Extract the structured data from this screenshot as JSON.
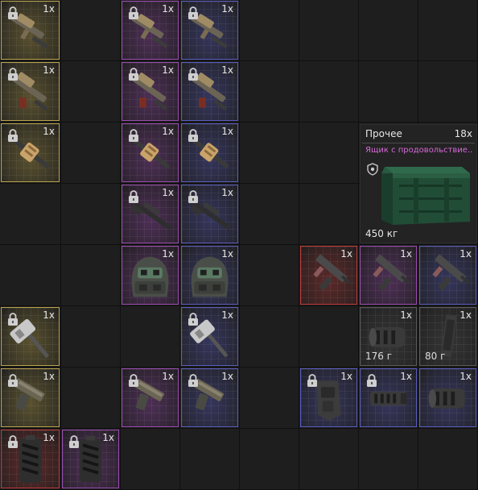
{
  "colors": {
    "gold": "#b8a24a",
    "purple": "#9a4ab0",
    "blue": "#5a5cc0",
    "red": "#c03a3a",
    "gray": "#5a5a5a",
    "featured_name": "#d76ad8"
  },
  "featured": {
    "category": "Прочее",
    "count": "18x",
    "name": "Ящик с продовольствие..",
    "weight": "450 кг",
    "icon": "crate-icon",
    "shield_icon": "shield-icon"
  },
  "slots": [
    {
      "col": 0,
      "row": 0,
      "rarity": "gold",
      "icon": "rifle-icon",
      "qty": "1x",
      "locked": true
    },
    {
      "col": 2,
      "row": 0,
      "rarity": "purple",
      "icon": "rifle-icon",
      "qty": "1x",
      "locked": true
    },
    {
      "col": 3,
      "row": 0,
      "rarity": "blue",
      "icon": "rifle-icon",
      "qty": "1x",
      "locked": true
    },
    {
      "col": 0,
      "row": 1,
      "rarity": "gold",
      "icon": "rifle-stock-icon",
      "qty": "1x",
      "locked": true
    },
    {
      "col": 2,
      "row": 1,
      "rarity": "purple",
      "icon": "rifle-stock-icon",
      "qty": "1x",
      "locked": true
    },
    {
      "col": 3,
      "row": 1,
      "rarity": "blue",
      "icon": "rifle-stock-icon",
      "qty": "1x",
      "locked": true
    },
    {
      "col": 0,
      "row": 2,
      "rarity": "gold",
      "icon": "wrapped-rifle-icon",
      "qty": "1x",
      "locked": true
    },
    {
      "col": 2,
      "row": 2,
      "rarity": "purple",
      "icon": "wrapped-rifle-icon",
      "qty": "1x",
      "locked": true
    },
    {
      "col": 3,
      "row": 2,
      "rarity": "blue",
      "icon": "wrapped-rifle-icon",
      "qty": "1x",
      "locked": true
    },
    {
      "col": 2,
      "row": 3,
      "rarity": "purple",
      "icon": "sniper-rifle-icon",
      "qty": "1x",
      "locked": true
    },
    {
      "col": 3,
      "row": 3,
      "rarity": "blue",
      "icon": "sniper-rifle-icon",
      "qty": "1x",
      "locked": true
    },
    {
      "col": 2,
      "row": 4,
      "rarity": "purple",
      "icon": "armored-helmet-icon",
      "qty": "1x",
      "locked": false
    },
    {
      "col": 3,
      "row": 4,
      "rarity": "blue",
      "icon": "armored-helmet-icon",
      "qty": "1x",
      "locked": false
    },
    {
      "col": 5,
      "row": 4,
      "rarity": "red",
      "icon": "smg-icon",
      "qty": "1x",
      "locked": false
    },
    {
      "col": 6,
      "row": 4,
      "rarity": "purple",
      "icon": "smg-icon",
      "qty": "1x",
      "locked": false
    },
    {
      "col": 7,
      "row": 4,
      "rarity": "blue",
      "icon": "smg-icon",
      "qty": "1x",
      "locked": false
    },
    {
      "col": 0,
      "row": 5,
      "rarity": "gold",
      "icon": "sledgehammer-icon",
      "qty": "1x",
      "locked": true
    },
    {
      "col": 3,
      "row": 5,
      "rarity": "blue",
      "icon": "sledgehammer-icon",
      "qty": "1x",
      "locked": true
    },
    {
      "col": 6,
      "row": 5,
      "rarity": "gray",
      "icon": "muzzle-brake-icon",
      "qty": "1x",
      "locked": false,
      "weight": "176 г"
    },
    {
      "col": 7,
      "row": 5,
      "rarity": "gray",
      "icon": "magazine-icon",
      "qty": "1x",
      "locked": false,
      "weight": "80 г"
    },
    {
      "col": 0,
      "row": 6,
      "rarity": "gold",
      "icon": "pistol-icon",
      "qty": "1x",
      "locked": true
    },
    {
      "col": 2,
      "row": 6,
      "rarity": "purple",
      "icon": "pistol-icon",
      "qty": "1x",
      "locked": true
    },
    {
      "col": 3,
      "row": 6,
      "rarity": "blue",
      "icon": "pistol-icon",
      "qty": "1x",
      "locked": true
    },
    {
      "col": 5,
      "row": 6,
      "rarity": "blue",
      "icon": "holster-icon",
      "qty": "1x",
      "locked": true
    },
    {
      "col": 6,
      "row": 6,
      "rarity": "blue",
      "icon": "compensator-icon",
      "qty": "1x",
      "locked": true
    },
    {
      "col": 7,
      "row": 6,
      "rarity": "blue",
      "icon": "muzzle-brake-icon",
      "qty": "1x",
      "locked": false
    },
    {
      "col": 0,
      "row": 7,
      "rarity": "red",
      "icon": "armor-plate-icon",
      "qty": "1x",
      "locked": true
    },
    {
      "col": 1,
      "row": 7,
      "rarity": "purple",
      "icon": "armor-plate-icon",
      "qty": "1x",
      "locked": true
    }
  ]
}
